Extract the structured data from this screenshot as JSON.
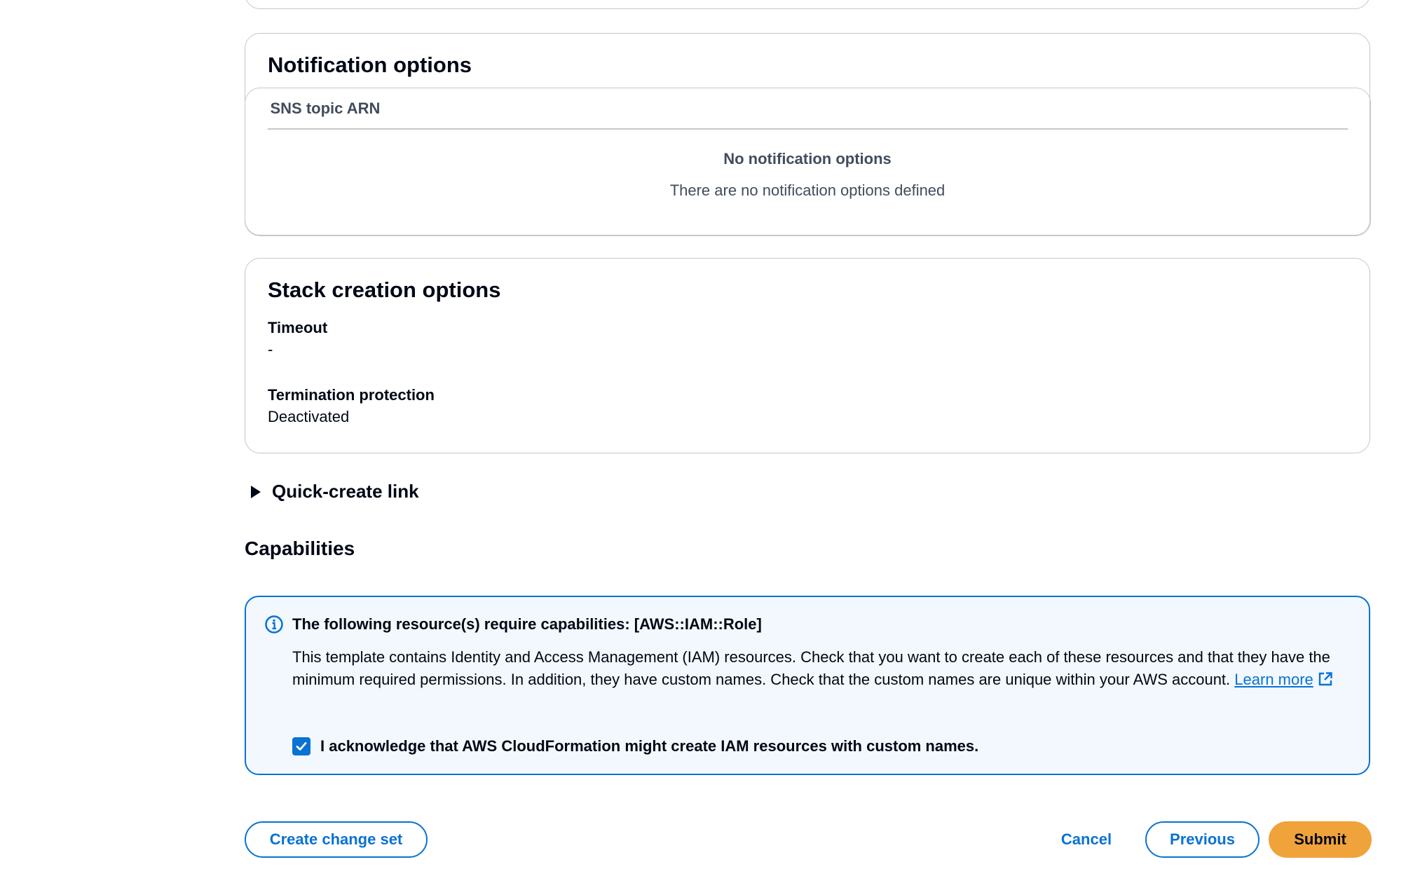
{
  "notification_options": {
    "title": "Notification options",
    "column_header": "SNS topic ARN",
    "empty_title": "No notification options",
    "empty_description": "There are no notification options defined"
  },
  "stack_creation_options": {
    "title": "Stack creation options",
    "timeout_label": "Timeout",
    "timeout_value": "-",
    "termination_label": "Termination protection",
    "termination_value": "Deactivated"
  },
  "quick_create": {
    "label": "Quick-create link",
    "expanded": false
  },
  "capabilities": {
    "heading": "Capabilities",
    "alert_title": "The following resource(s) require capabilities: [AWS::IAM::Role]",
    "alert_body": "This template contains Identity and Access Management (IAM) resources. Check that you want to create each of these resources and that they have the minimum required permissions. In addition, they have custom names. Check that the custom names are unique within your AWS account.",
    "learn_more": "Learn more",
    "acknowledge_label": "I acknowledge that AWS CloudFormation might create IAM resources with custom names.",
    "acknowledged": true,
    "icon": "info-icon"
  },
  "actions": {
    "create_change_set": "Create change set",
    "cancel": "Cancel",
    "previous": "Previous",
    "submit": "Submit"
  },
  "colors": {
    "accent": "#0972d3",
    "submit": "#f0a33a",
    "alert_bg": "#f2f8fd",
    "border": "#c6c6cd"
  }
}
